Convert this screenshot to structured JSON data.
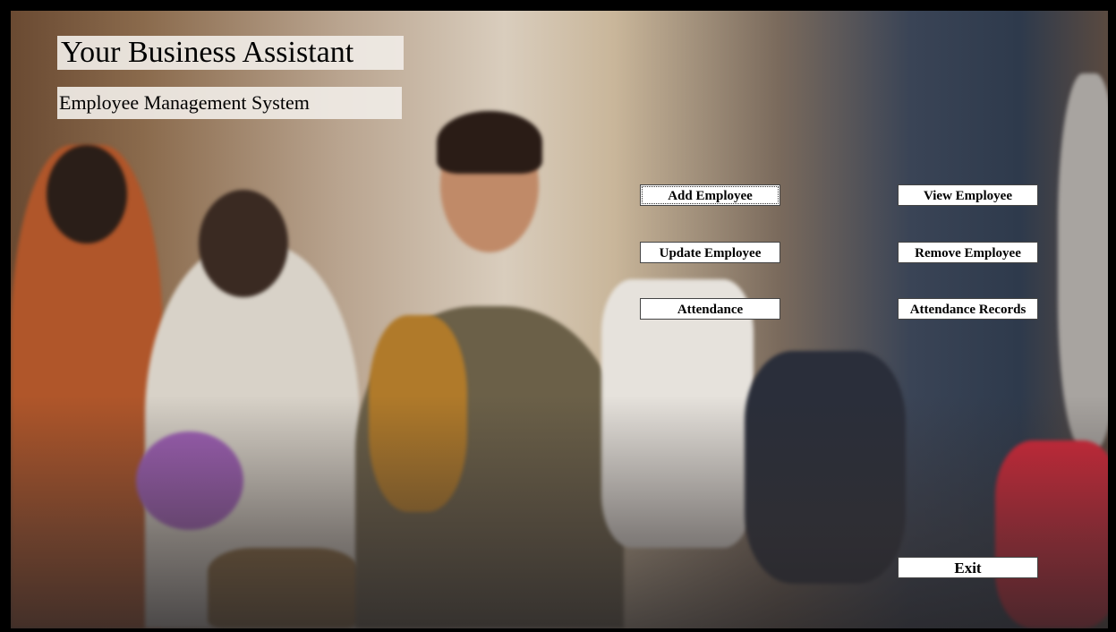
{
  "app": {
    "title": "Your Business Assistant",
    "subtitle": "Employee Management System"
  },
  "buttons": {
    "add_employee": "Add Employee",
    "view_employee": "View Employee",
    "update_employee": "Update Employee",
    "remove_employee": "Remove Employee",
    "attendance": "Attendance",
    "attendance_records": "Attendance Records",
    "exit": "Exit"
  },
  "colors": {
    "frame": "#000000",
    "button_bg": "#ffffff",
    "title_bg": "#f0ece6"
  }
}
